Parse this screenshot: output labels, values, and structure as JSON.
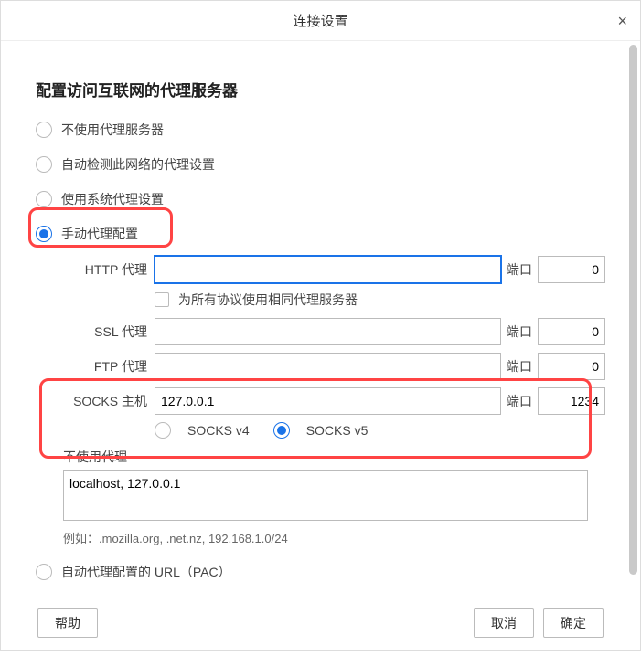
{
  "dialog": {
    "title": "连接设置",
    "heading": "配置访问互联网的代理服务器"
  },
  "options": {
    "no_proxy": "不使用代理服务器",
    "auto_detect": "自动检测此网络的代理设置",
    "system": "使用系统代理设置",
    "manual": "手动代理配置",
    "pac": "自动代理配置的 URL（PAC）"
  },
  "proxy": {
    "http_label": "HTTP 代理",
    "http_value": "",
    "http_port": "0",
    "same_for_all": "为所有协议使用相同代理服务器",
    "ssl_label": "SSL 代理",
    "ssl_value": "",
    "ssl_port": "0",
    "ftp_label": "FTP 代理",
    "ftp_value": "",
    "ftp_port": "0",
    "socks_label": "SOCKS 主机",
    "socks_value": "127.0.0.1",
    "socks_port": "1234",
    "port_label": "端口",
    "socks_v4": "SOCKS v4",
    "socks_v5": "SOCKS v5"
  },
  "noproxy": {
    "label": "不使用代理",
    "value": "localhost, 127.0.0.1",
    "example": "例如：.mozilla.org, .net.nz, 192.168.1.0/24"
  },
  "buttons": {
    "help": "帮助",
    "cancel": "取消",
    "ok": "确定"
  }
}
